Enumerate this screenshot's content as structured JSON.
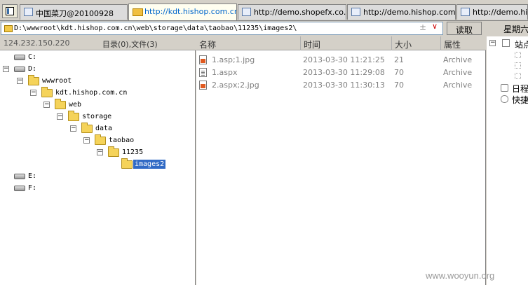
{
  "tabs": [
    {
      "label": "中国菜刀@20100928"
    },
    {
      "label": "http://kdt.hishop.com.cn..."
    },
    {
      "label": "http://demo.shopefx.co..."
    },
    {
      "label": "http://demo.hishop.com...."
    },
    {
      "label": "http://demo.his"
    }
  ],
  "address": {
    "path": "D:\\wwwroot\\kdt.hishop.com.cn\\web\\storage\\data\\taobao\\11235\\images2\\",
    "read_button": "读取",
    "weekday": "星期六"
  },
  "left_panel": {
    "ip": "124.232.150.220",
    "counts": "目录(0),文件(3)"
  },
  "tree": {
    "c": "C:",
    "d": "D:",
    "wwwroot": "wwwroot",
    "site": "kdt.hishop.com.cn",
    "web": "web",
    "storage": "storage",
    "data": "data",
    "taobao": "taobao",
    "n11235": "11235",
    "images2": "images2",
    "e": "E:",
    "f": "F:",
    "expand_sign": "⊟"
  },
  "file_list": {
    "columns": {
      "name": "名称",
      "time": "时间",
      "size": "大小",
      "attr": "属性"
    },
    "rows": [
      {
        "name": "1.asp;1.jpg",
        "time": "2013-03-30 11:21:25",
        "size": "21",
        "attr": "Archive",
        "icon": "image-file-icon"
      },
      {
        "name": "1.aspx",
        "time": "2013-03-30 11:29:08",
        "size": "70",
        "attr": "Archive",
        "icon": "text-file-icon"
      },
      {
        "name": "2.aspx;2.jpg",
        "time": "2013-03-30 11:30:13",
        "size": "70",
        "attr": "Archive",
        "icon": "image-file-icon"
      }
    ]
  },
  "side_panel": {
    "site_label": "站点",
    "log_label": "日程",
    "quick_label": "快捷"
  },
  "watermark": "www.wooyun.org",
  "colors": {
    "selection": "#316ac5",
    "active_tab_text": "#0066cc",
    "folder": "#f5d35a"
  }
}
